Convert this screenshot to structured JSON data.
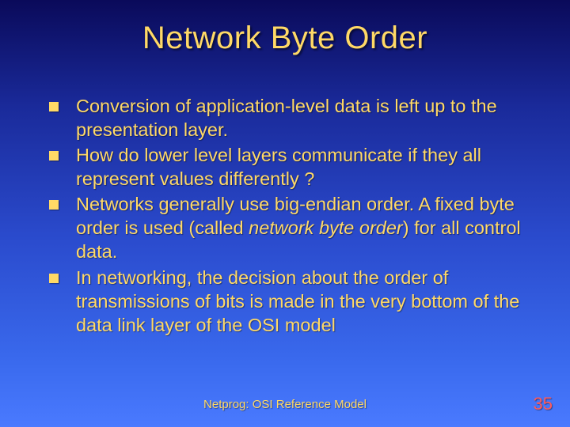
{
  "title": "Network Byte Order",
  "bullets": [
    {
      "text": "Conversion of application-level data is left up to the presentation layer."
    },
    {
      "text": "How do lower level layers communicate if they all represent values differently ?"
    },
    {
      "pre": "Networks generally use big-endian order. A fixed byte order is used (called ",
      "em": "network byte order",
      "post": ") for all control data."
    },
    {
      "text": "In networking, the decision about the order of transmissions of bits is made in the very bottom of the data link layer of the OSI model"
    }
  ],
  "footer": "Netprog:  OSI Reference Model",
  "page_number": "35"
}
